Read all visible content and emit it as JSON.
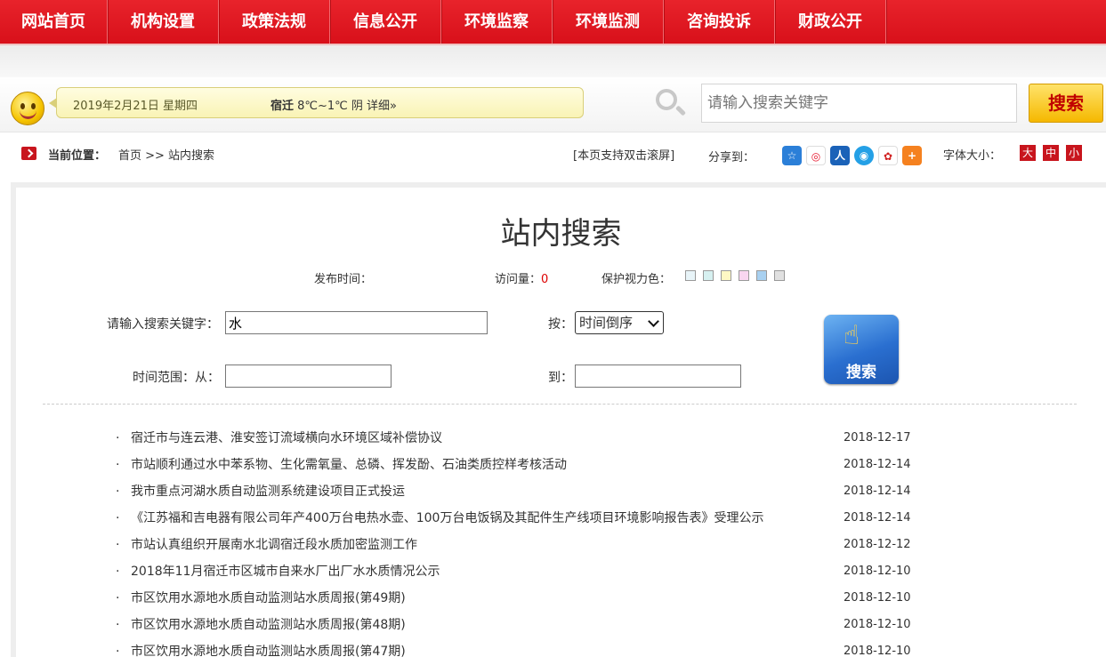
{
  "nav": {
    "items": [
      "网站首页",
      "机构设置",
      "政策法规",
      "信息公开",
      "环境监察",
      "环境监测",
      "咨询投诉",
      "财政公开"
    ]
  },
  "info": {
    "date": "2019年2月21日  星期四",
    "city": "宿迁",
    "weather": " 8℃~1℃ 阴 详细»"
  },
  "top_search": {
    "placeholder": "请输入搜索关键字",
    "button": "搜索"
  },
  "breadcrumb": {
    "label": "当前位置：",
    "path": "首页 >> 站内搜索"
  },
  "toolbar": {
    "double_click_scroll": "[本页支持双击滚屏]",
    "share_label": "分享到：",
    "share_icons": [
      "qzone-icon",
      "weibo-icon",
      "renren-icon",
      "tencent-icon",
      "kaixin-icon",
      "more-share-icon"
    ],
    "font_label": "字体大小：",
    "font_sizes": [
      "大",
      "中",
      "小"
    ]
  },
  "page": {
    "title": "站内搜索",
    "publish_time_label": "发布时间：",
    "visits_label": "访问量：",
    "visits_value": "0",
    "eye_color_label": "保护视力色：",
    "eye_colors": [
      "#e8f4f8",
      "#d6f0f0",
      "#fff8c4",
      "#f8d6f0",
      "#a8d0f0",
      "#e0e0e0"
    ]
  },
  "form": {
    "keyword_label": "请输入搜索关键字：",
    "keyword_value": "水",
    "sort_label": "按：",
    "sort_value": "时间倒序",
    "range_from_label": "时间范围：从：",
    "range_from_value": "",
    "range_to_label": "到：",
    "range_to_value": "",
    "search_button": "搜索"
  },
  "results": [
    {
      "title": "宿迁市与连云港、淮安签订流域横向水环境区域补偿协议",
      "date": "2018-12-17"
    },
    {
      "title": "市站顺利通过水中苯系物、生化需氧量、总磷、挥发酚、石油类质控样考核活动",
      "date": "2018-12-14"
    },
    {
      "title": "我市重点河湖水质自动监测系统建设项目正式投运",
      "date": "2018-12-14"
    },
    {
      "title": "《江苏福和吉电器有限公司年产400万台电热水壶、100万台电饭锅及其配件生产线项目环境影响报告表》受理公示",
      "date": "2018-12-14"
    },
    {
      "title": "市站认真组织开展南水北调宿迁段水质加密监测工作",
      "date": "2018-12-12"
    },
    {
      "title": "2018年11月宿迁市区城市自来水厂出厂水水质情况公示",
      "date": "2018-12-10"
    },
    {
      "title": "市区饮用水源地水质自动监测站水质周报(第49期)",
      "date": "2018-12-10"
    },
    {
      "title": "市区饮用水源地水质自动监测站水质周报(第48期)",
      "date": "2018-12-10"
    },
    {
      "title": "市区饮用水源地水质自动监测站水质周报(第47期)",
      "date": "2018-12-10"
    }
  ]
}
